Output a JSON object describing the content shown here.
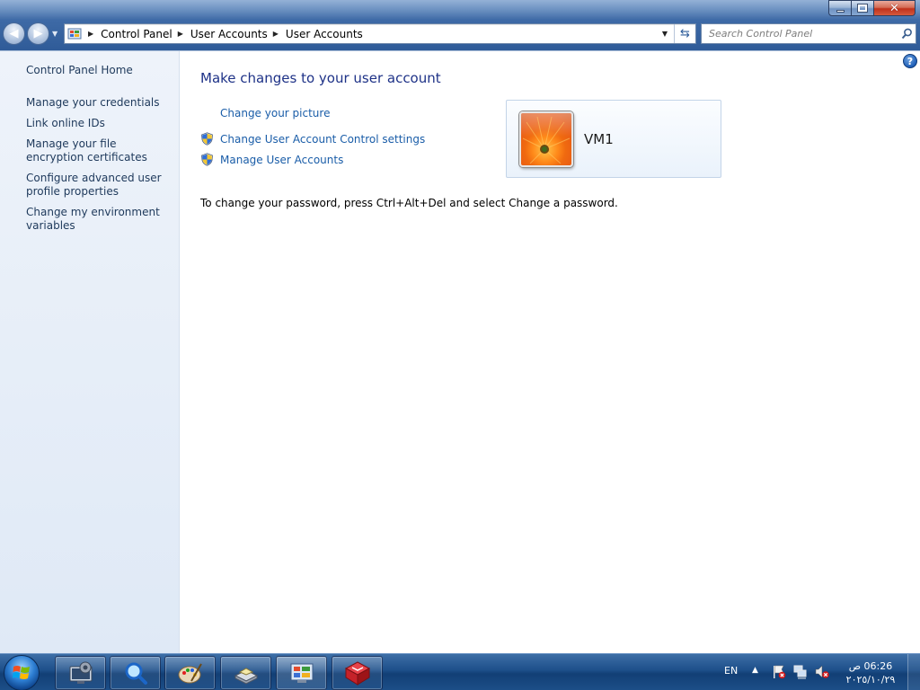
{
  "window": {
    "controls": {
      "minimize_icon": "minimize-icon",
      "restore_icon": "restore-icon",
      "close_icon": "close-icon"
    }
  },
  "address_bar": {
    "breadcrumbs": [
      "Control Panel",
      "User Accounts",
      "User Accounts"
    ]
  },
  "search": {
    "placeholder": "Search Control Panel"
  },
  "sidebar": {
    "items": [
      {
        "label": "Control Panel Home"
      },
      {
        "label": "Manage your credentials"
      },
      {
        "label": "Link online IDs"
      },
      {
        "label": "Manage your file encryption certificates"
      },
      {
        "label": "Configure advanced user profile properties"
      },
      {
        "label": "Change my environment variables"
      }
    ]
  },
  "main": {
    "title": "Make changes to your user account",
    "tasks": [
      {
        "label": "Change your picture",
        "icon": ""
      },
      {
        "label": "Change User Account Control settings",
        "icon": "uac-shield-icon"
      },
      {
        "label": "Manage User Accounts",
        "icon": "uac-shield-icon"
      }
    ],
    "user": {
      "name": "VM1"
    },
    "password_note": "To change your password, press Ctrl+Alt+Del and select Change a password."
  },
  "taskbar": {
    "pinned": [
      {
        "icon": "remote-desktop-icon"
      },
      {
        "icon": "magnifier-icon"
      },
      {
        "icon": "paint-icon"
      },
      {
        "icon": "scanner-icon"
      },
      {
        "icon": "control-panel-icon",
        "active": true
      },
      {
        "icon": "vbox-cube-icon"
      }
    ],
    "tray": {
      "language": "EN",
      "time": "06:26 ص",
      "date": "٢٠٢٥/١٠/٢٩"
    }
  },
  "colors": {
    "link": "#1a5da8",
    "title": "#1e3287",
    "sidebar_bg": "#eef3fa",
    "taskbar": "#1d4f8a"
  }
}
